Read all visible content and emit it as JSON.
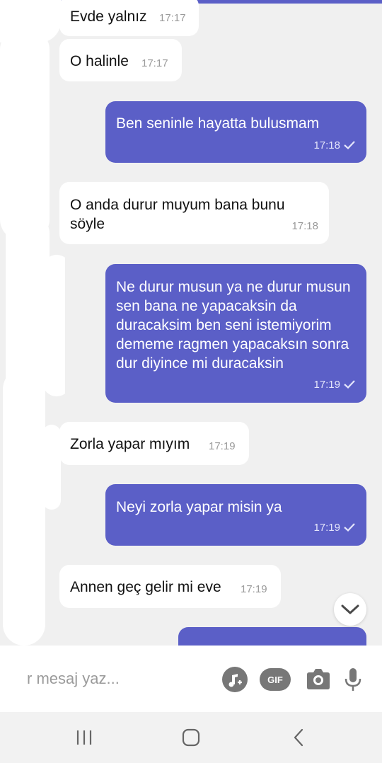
{
  "messages": [
    {
      "direction": "in",
      "text": "Evde yalnız",
      "time": "17:17"
    },
    {
      "direction": "in",
      "text": "O halinle",
      "time": "17:17"
    },
    {
      "direction": "out",
      "text": "Ben seninle hayatta bulusmam",
      "time": "17:18"
    },
    {
      "direction": "in",
      "text": "O anda durur muyum bana bunu söyle",
      "time": "17:18"
    },
    {
      "direction": "out",
      "text": "Ne durur musun ya ne durur musun sen bana ne yapacaksin da duracaksim ben seni istemiyorim dememe ragmen yapacaksın sonra dur diyince mi duracaksin",
      "time": "17:19"
    },
    {
      "direction": "in",
      "text": "Zorla yapar mıyım",
      "time": "17:19"
    },
    {
      "direction": "out",
      "text": "Neyi zorla yapar misin ya",
      "time": "17:19"
    },
    {
      "direction": "in",
      "text": "Annen geç gelir mi eve",
      "time": "17:19"
    },
    {
      "direction": "out",
      "text": "",
      "time": ""
    }
  ],
  "composer": {
    "placeholder": "r mesaj yaz...",
    "buttons": {
      "sticker": "sticker-icon",
      "gif": "GIF",
      "camera": "camera-icon",
      "mic": "microphone-icon"
    }
  },
  "navbar": {
    "recents": "recents-icon",
    "home": "home-icon",
    "back": "back-icon"
  },
  "colors": {
    "outgoing": "#5b5fc7",
    "incoming": "#ffffff",
    "background": "#f0f0f0"
  }
}
